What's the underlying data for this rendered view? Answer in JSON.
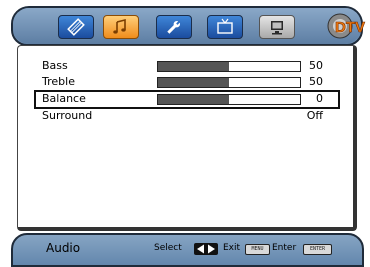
{
  "tabs": [
    {
      "name": "picture",
      "icon": "film-icon",
      "active": false
    },
    {
      "name": "audio",
      "icon": "music-note-icon",
      "active": true
    },
    {
      "name": "setup",
      "icon": "wrench-icon",
      "active": false
    },
    {
      "name": "channel",
      "icon": "tv-icon",
      "active": false
    },
    {
      "name": "pc",
      "icon": "monitor-icon",
      "active": false
    }
  ],
  "logo": {
    "text": "DTV"
  },
  "menu": {
    "items": [
      {
        "label": "Bass",
        "value": "50",
        "level": 0.5
      },
      {
        "label": "Treble",
        "value": "50",
        "level": 0.5
      },
      {
        "label": "Balance",
        "value": "0",
        "level": 0.5,
        "selected": true
      },
      {
        "label": "Surround",
        "value": "Off"
      }
    ]
  },
  "status": {
    "title": "Audio",
    "select_label": "Select",
    "exit_label": "Exit",
    "exit_key": "MENU",
    "enter_label": "Enter",
    "enter_key": "ENTER"
  },
  "colors": {
    "active_tab": "#f5a030",
    "tab": "#2f6fc4",
    "bar_fill": "#555555"
  }
}
